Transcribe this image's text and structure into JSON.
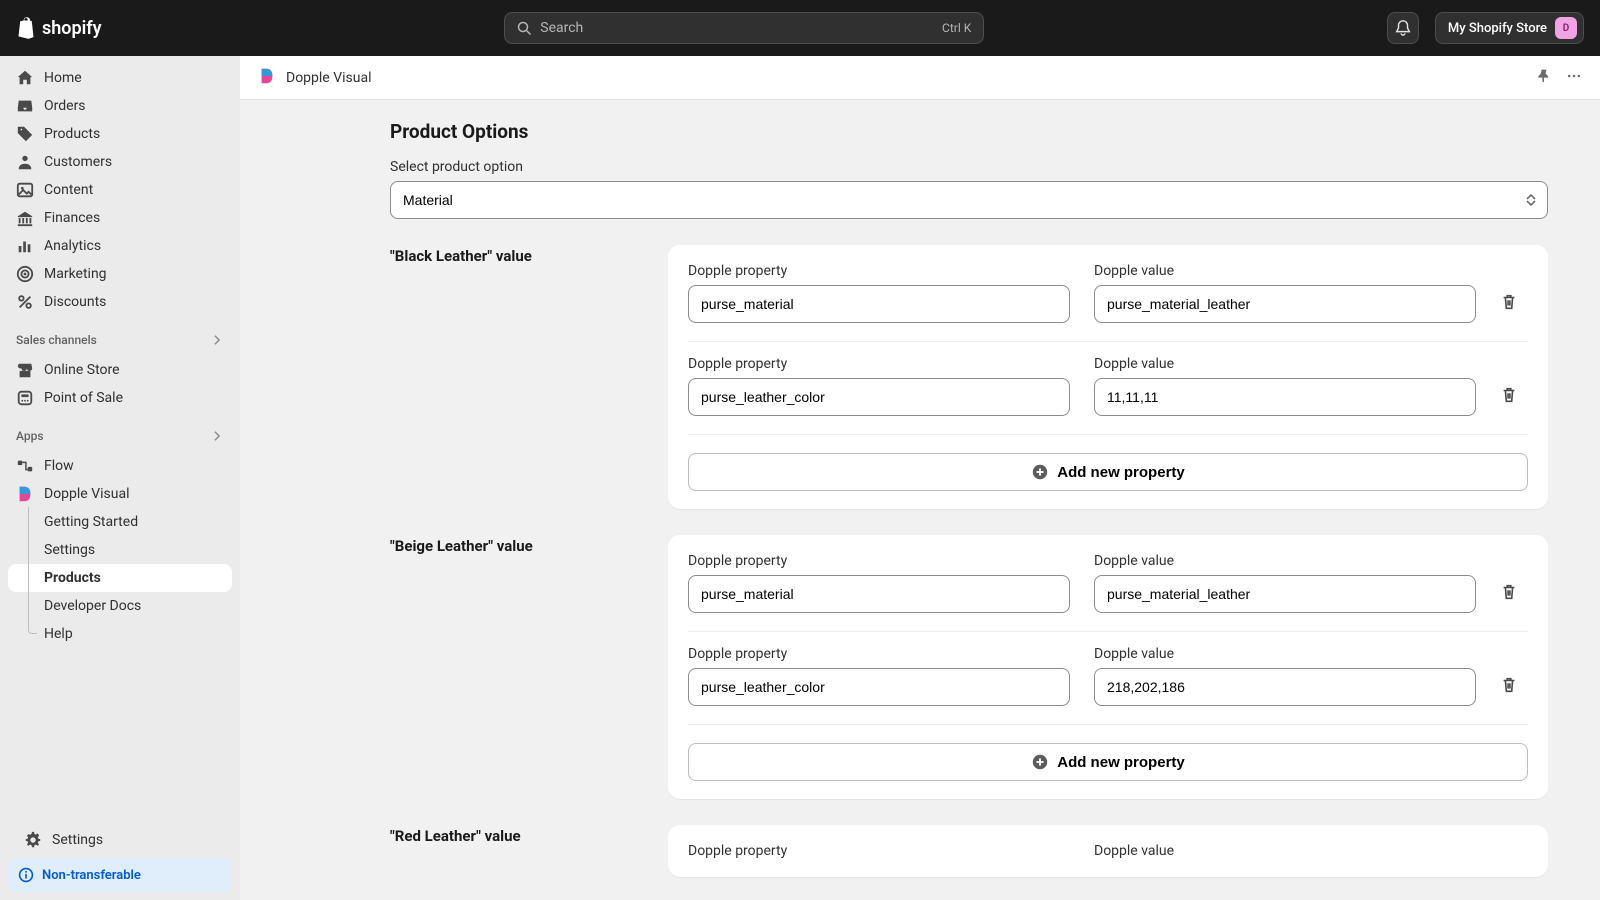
{
  "header": {
    "search_placeholder": "Search",
    "search_shortcut": "Ctrl K",
    "store_name": "My Shopify Store",
    "avatar_initial": "D",
    "brand_label": "shopify"
  },
  "sidebar": {
    "items": [
      {
        "label": "Home"
      },
      {
        "label": "Orders"
      },
      {
        "label": "Products"
      },
      {
        "label": "Customers"
      },
      {
        "label": "Content"
      },
      {
        "label": "Finances"
      },
      {
        "label": "Analytics"
      },
      {
        "label": "Marketing"
      },
      {
        "label": "Discounts"
      }
    ],
    "section_channels": "Sales channels",
    "channels": [
      {
        "label": "Online Store"
      },
      {
        "label": "Point of Sale"
      }
    ],
    "section_apps": "Apps",
    "apps": [
      {
        "label": "Flow"
      },
      {
        "label": "Dopple Visual"
      }
    ],
    "app_subitems": [
      {
        "label": "Getting Started"
      },
      {
        "label": "Settings"
      },
      {
        "label": "Products"
      },
      {
        "label": "Developer Docs"
      },
      {
        "label": "Help"
      }
    ],
    "settings_label": "Settings",
    "badge_label": "Non-transferable"
  },
  "appbar": {
    "title": "Dopple Visual"
  },
  "page": {
    "title": "Product Options",
    "select_label": "Select product option",
    "select_value": "Material",
    "property_label": "Dopple property",
    "value_label": "Dopple value",
    "add_button_label": "Add new property",
    "values": [
      {
        "title": "\"Black Leather\" value",
        "rows": [
          {
            "prop": "purse_material",
            "val": "purse_material_leather"
          },
          {
            "prop": "purse_leather_color",
            "val": "11,11,11"
          }
        ]
      },
      {
        "title": "\"Beige Leather\" value",
        "rows": [
          {
            "prop": "purse_material",
            "val": "purse_material_leather"
          },
          {
            "prop": "purse_leather_color",
            "val": "218,202,186"
          }
        ]
      },
      {
        "title": "\"Red Leather\" value",
        "rows": [
          {
            "prop": "",
            "val": ""
          }
        ]
      }
    ]
  }
}
